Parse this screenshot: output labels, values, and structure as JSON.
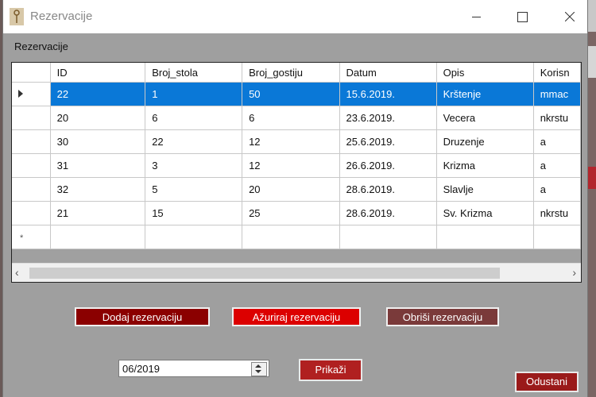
{
  "window": {
    "title": "Rezervacije"
  },
  "group": {
    "label": "Rezervacije"
  },
  "grid": {
    "columns": [
      "ID",
      "Broj_stola",
      "Broj_gostiju",
      "Datum",
      "Opis",
      "Korisn"
    ],
    "rows": [
      [
        "22",
        "1",
        "50",
        "15.6.2019.",
        "Krštenje",
        "mmac"
      ],
      [
        "20",
        "6",
        "6",
        "23.6.2019.",
        "Vecera",
        "nkrstu"
      ],
      [
        "30",
        "22",
        "12",
        "25.6.2019.",
        "Druzenje",
        "a"
      ],
      [
        "31",
        "3",
        "12",
        "26.6.2019.",
        "Krizma",
        "a"
      ],
      [
        "32",
        "5",
        "20",
        "28.6.2019.",
        "Slavlje",
        "a"
      ],
      [
        "21",
        "15",
        "25",
        "28.6.2019.",
        "Sv. Krizma",
        "nkrstu"
      ]
    ],
    "new_row_marker": "*",
    "selected_row": 0
  },
  "buttons": {
    "add": "Dodaj rezervaciju",
    "update": "Ažuriraj rezervaciju",
    "delete": "Obriši rezervaciju",
    "show": "Prikaži",
    "quit": "Odustani"
  },
  "date_picker": {
    "value": "06/2019"
  },
  "colors": {
    "selection": "#0a78d7",
    "add_button": "#8b0000",
    "update_button": "#dc0000",
    "delete_button": "#7a3a3a",
    "show_button": "#b02020",
    "quit_button": "#9a1a1a",
    "form_background": "#9f9f9f"
  }
}
